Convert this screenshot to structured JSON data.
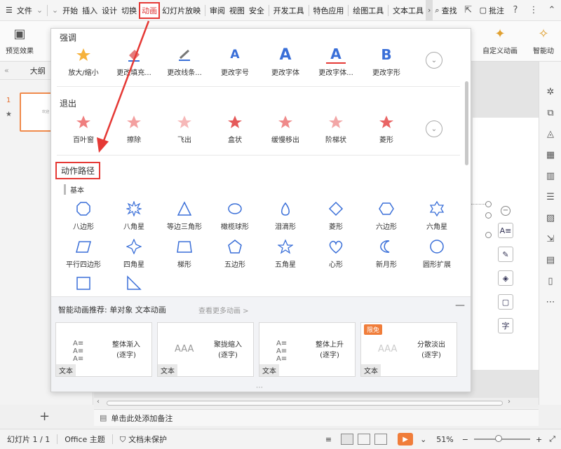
{
  "menu": {
    "file": "文件",
    "tabs": [
      "开始",
      "插入",
      "设计",
      "切换",
      "动画",
      "幻灯片放映",
      "审阅",
      "视图",
      "安全",
      "开发工具",
      "特色应用",
      "绘图工具",
      "文本工具"
    ],
    "active_tab": "动画",
    "search": "查找",
    "annotate": "批注"
  },
  "ribbon": {
    "preview": "预览效果",
    "custom_anim": "自定义动画",
    "smart": "智能动"
  },
  "leftpane": {
    "tab_outline": "大纲",
    "slide_number": "1",
    "thumb_text": "欢迎"
  },
  "panel": {
    "emphasis": {
      "title": "强调",
      "items": [
        "放大/缩小",
        "更改填充...",
        "更改线条...",
        "更改字号",
        "更改字体",
        "更改字体...",
        "更改字形"
      ]
    },
    "exit": {
      "title": "退出",
      "items": [
        "百叶窗",
        "擦除",
        "飞出",
        "盒状",
        "缓慢移出",
        "阶梯状",
        "菱形"
      ]
    },
    "motion": {
      "title": "动作路径",
      "basic": "基本",
      "row1": [
        "八边形",
        "八角星",
        "等边三角形",
        "橄榄球形",
        "泪滴形",
        "菱形",
        "六边形",
        "六角星"
      ],
      "row2": [
        "平行四边形",
        "四角星",
        "梯形",
        "五边形",
        "五角星",
        "心形",
        "新月形",
        "圆形扩展"
      ]
    },
    "smart": {
      "header": "智能动画推荐:  单对象 文本动画",
      "more": "查看更多动画 >",
      "cards": [
        {
          "name": "整体渐入\n(逐字)",
          "cap": "文本",
          "badge": ""
        },
        {
          "name": "聚拢缩入\n(逐字)",
          "cap": "文本",
          "badge": ""
        },
        {
          "name": "整体上升\n(逐字)",
          "cap": "文本",
          "badge": ""
        },
        {
          "name": "分散淡出\n(逐字)",
          "cap": "文本",
          "badge": "限免"
        }
      ]
    }
  },
  "notes": "单击此处添加备注",
  "status": {
    "slide": "幻灯片 1 / 1",
    "theme": "Office 主题",
    "protect": "文档未保护",
    "zoom": "51%"
  },
  "colors": {
    "accent": "#e53935",
    "orange": "#f07d3a",
    "icon_blue": "#3a6fd8"
  }
}
